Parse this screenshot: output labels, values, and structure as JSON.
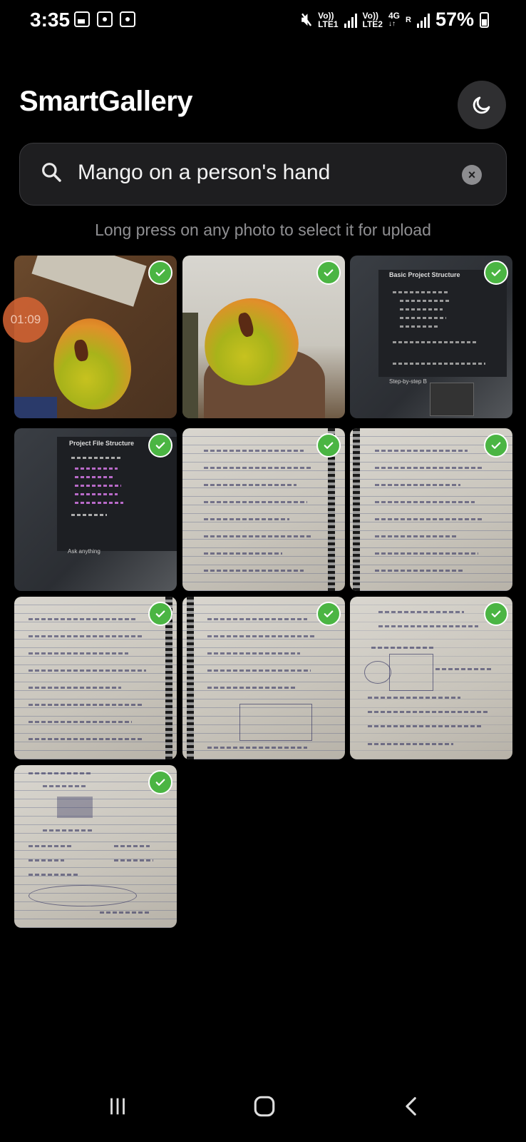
{
  "status_bar": {
    "time": "3:35",
    "notification_icons": [
      "image-icon",
      "screenshot-icon",
      "focus-icon"
    ],
    "sim1_label_top": "Vo))",
    "sim1_label_bottom": "LTE1",
    "sim2_label_top": "Vo))",
    "sim2_label_bottom": "LTE2",
    "network_type": "4G",
    "roaming": "R",
    "battery": "57%"
  },
  "header": {
    "title": "SmartGallery",
    "theme_toggle_icon": "moon-icon"
  },
  "search": {
    "query": "Mango on a person's hand",
    "icon": "search-icon",
    "clear_icon": "clear-icon"
  },
  "hint": "Long press on any photo to select it for upload",
  "recording_timer": "01:09",
  "photos": [
    {
      "subject": "mango-on-table",
      "selected": true
    },
    {
      "subject": "mango-in-hand",
      "selected": true
    },
    {
      "subject": "screen-project-structure",
      "selected": true
    },
    {
      "subject": "screen-project-file-structure",
      "selected": true
    },
    {
      "subject": "notebook-page",
      "selected": true
    },
    {
      "subject": "notebook-page",
      "selected": true
    },
    {
      "subject": "notebook-page",
      "selected": true
    },
    {
      "subject": "notebook-page",
      "selected": true
    },
    {
      "subject": "notebook-page",
      "selected": true
    },
    {
      "subject": "notebook-page",
      "selected": true
    }
  ],
  "screen_text": {
    "photo3_title": "Basic Project Structure",
    "photo3_footer": "Step-by-step B",
    "photo4_title": "Project File Structure",
    "photo4_footer": "Ask anything"
  },
  "colors": {
    "background": "#000000",
    "search_bg": "#1e1e20",
    "check_green": "#4bb543",
    "hint_gray": "#8f8f92"
  },
  "navigation": [
    "recents-icon",
    "home-icon",
    "back-icon"
  ]
}
